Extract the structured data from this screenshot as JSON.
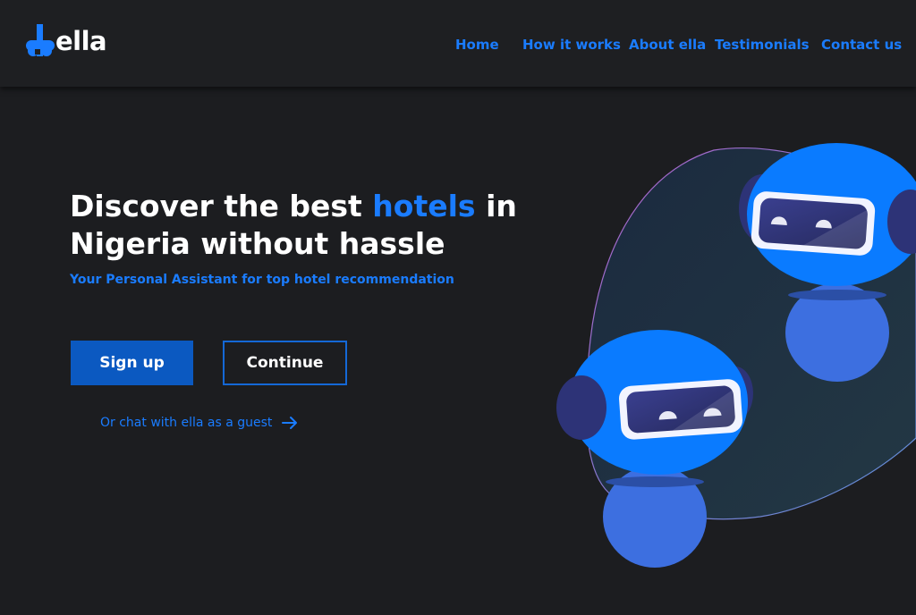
{
  "logo": {
    "text": "ella",
    "icon": "ella-logo-mark"
  },
  "nav": [
    {
      "label": "Home"
    },
    {
      "label": "How it works"
    },
    {
      "label": "About ella"
    },
    {
      "label": "Testimonials"
    },
    {
      "label": "Contact us"
    }
  ],
  "hero": {
    "title_part1": "Discover the best ",
    "title_accent": "hotels",
    "title_part2": " in Nigeria without hassle",
    "subtitle": "Your Personal Assistant for top hotel recommendation",
    "signup_label": "Sign up",
    "continue_label": "Continue",
    "guest_link": "Or chat with ella as a guest",
    "guest_icon": "arrow-right-icon"
  },
  "illustration": {
    "icon": "robot-assistants-illustration"
  },
  "colors": {
    "accent": "#1a7cff",
    "background": "#1c1d20",
    "header": "#1e1f22",
    "signup_button": "#0b59c1",
    "robot_head": "#0a7bff",
    "robot_body": "#3d6fe0"
  }
}
